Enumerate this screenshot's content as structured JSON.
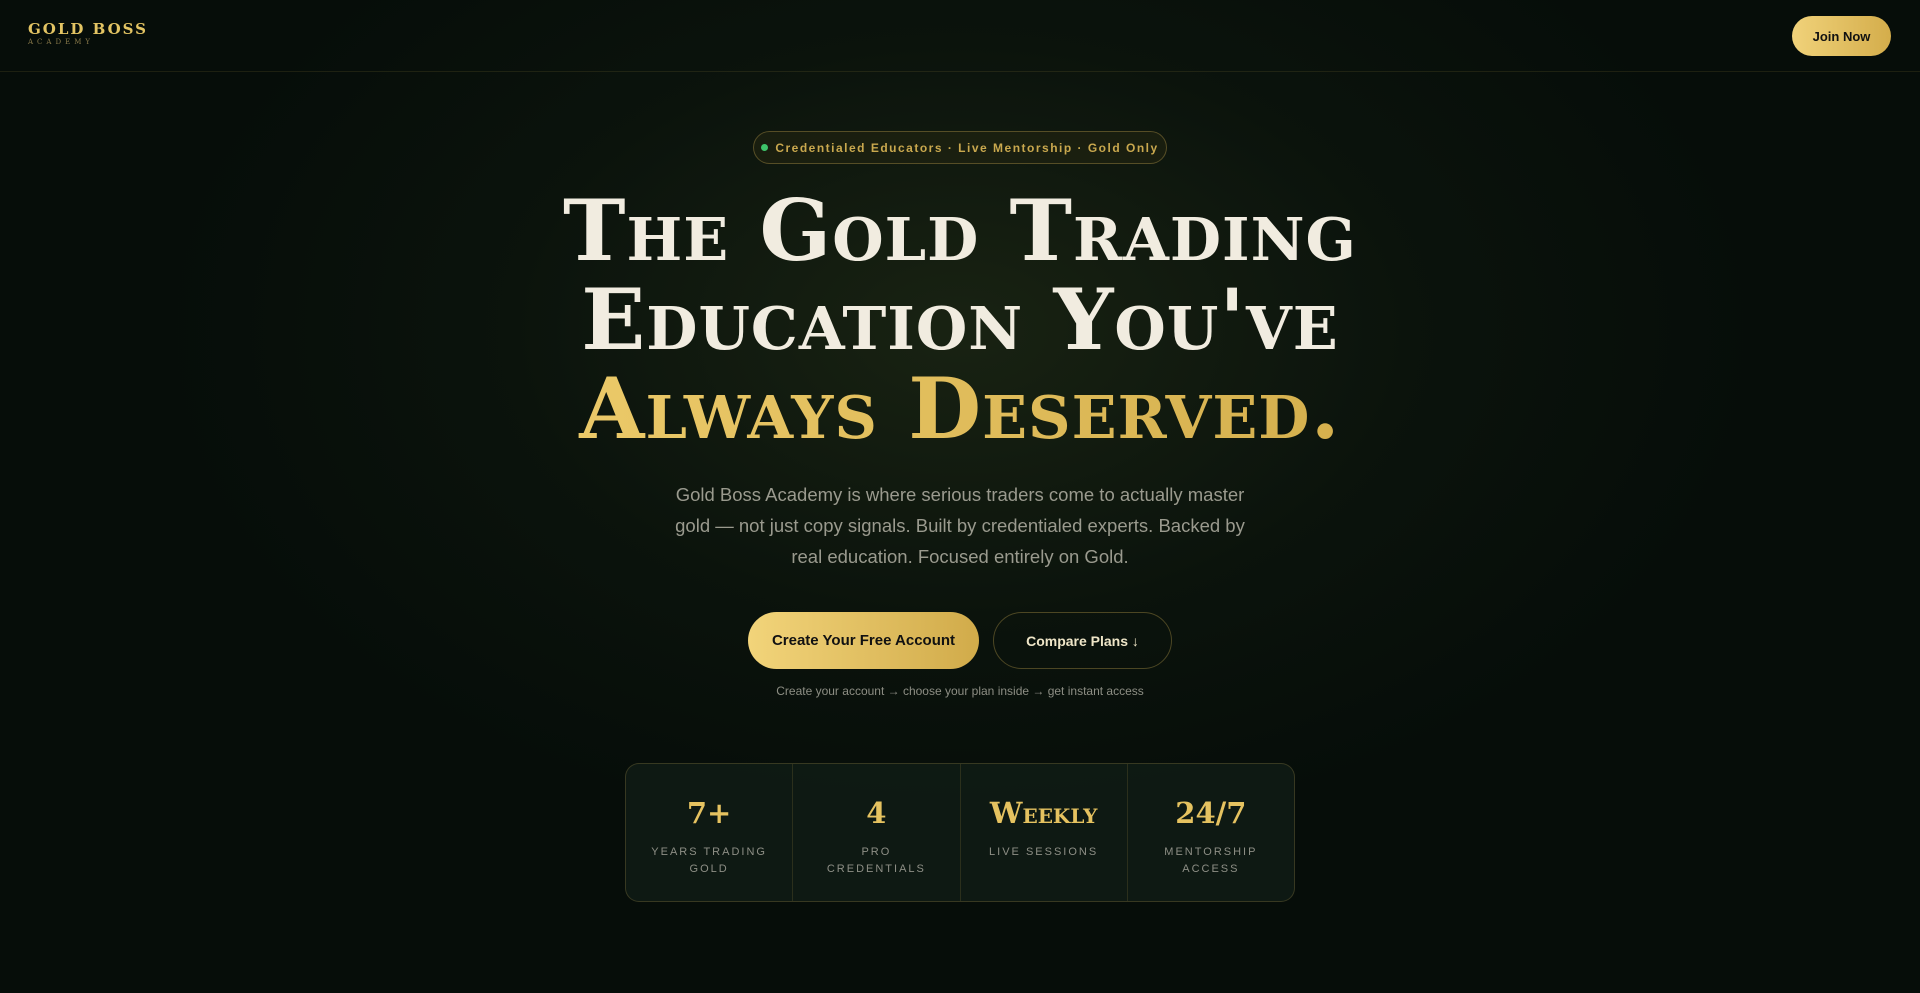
{
  "header": {
    "logo_main": "GOLD BOSS",
    "logo_sub": "ACADEMY",
    "join_label": "Join Now"
  },
  "hero": {
    "badge_text": "Credentialed Educators · Live Mentorship · Gold Only",
    "headline_line1": "The Gold Trading",
    "headline_line2": "Education You've",
    "headline_line3": "Always Deserved.",
    "subtext": "Gold Boss Academy is where serious traders come to actually master gold — not just copy signals. Built by credentialed experts. Backed by real education. Focused entirely on Gold.",
    "cta_primary": "Create Your Free Account",
    "cta_secondary": "Compare Plans ↓",
    "cta_note": "Create your account → choose your plan inside → get instant access"
  },
  "stats": [
    {
      "value": "7+",
      "label": "Years Trading Gold"
    },
    {
      "value": "4",
      "label": "Pro Credentials"
    },
    {
      "value": "Weekly",
      "label": "Live Sessions"
    },
    {
      "value": "24/7",
      "label": "Mentorship Access"
    }
  ],
  "colors": {
    "accent_gold": "#e3c463",
    "background": "#060d09",
    "status_dot": "#3ec46a"
  }
}
